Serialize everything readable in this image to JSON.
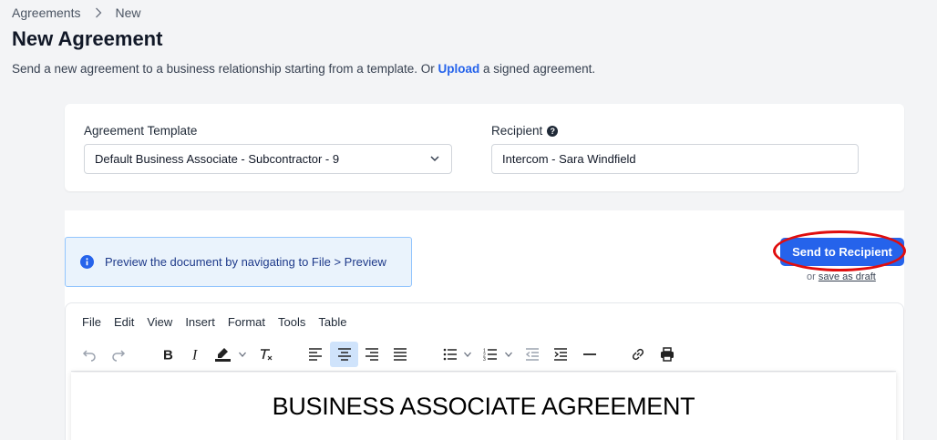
{
  "breadcrumb": {
    "root": "Agreements",
    "current": "New"
  },
  "page": {
    "title": "New Agreement",
    "subtitle_before": "Send a new agreement to a business relationship starting from a template. Or ",
    "subtitle_link": "Upload",
    "subtitle_after": " a signed agreement."
  },
  "form": {
    "template_label": "Agreement Template",
    "template_value": "Default Business Associate - Subcontractor - 9",
    "recipient_label": "Recipient",
    "recipient_help": "?",
    "recipient_value": "Intercom - Sara Windfield"
  },
  "notice": {
    "text": "Preview the document by navigating to File > Preview"
  },
  "actions": {
    "send_label": "Send to Recipient",
    "or_text": "or ",
    "draft_label": "save as draft"
  },
  "editor": {
    "menu": [
      "File",
      "Edit",
      "View",
      "Insert",
      "Format",
      "Tools",
      "Table"
    ],
    "active_alignment": "align-center",
    "document_heading": "BUSINESS ASSOCIATE AGREEMENT"
  },
  "colors": {
    "accent": "#2563eb",
    "highlight_ring": "#e00d0d",
    "info_bg": "#eaf3fc"
  }
}
